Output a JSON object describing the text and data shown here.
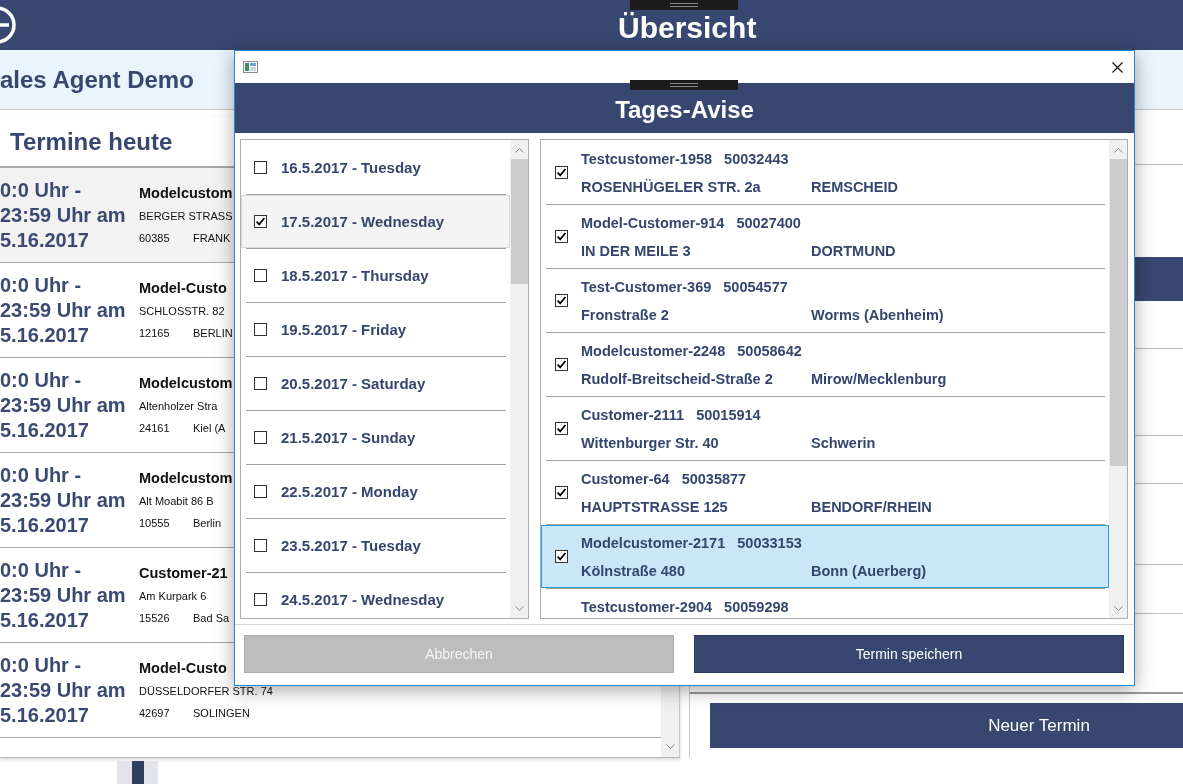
{
  "app": {
    "title": "Übersicht",
    "subtitle": "ales Agent Demo"
  },
  "appointments": {
    "title": "Termine heute",
    "rows": [
      {
        "time": "0:0 Uhr - 23:59 Uhr am 5.16.2017",
        "customer": "Modelcustom",
        "street": "BERGER STRASS",
        "zip": "60385",
        "city": "FRANK",
        "selected": true
      },
      {
        "time": "0:0 Uhr - 23:59 Uhr am 5.16.2017",
        "customer": "Model-Custo",
        "street": "SCHLOSSTR. 82",
        "zip": "12165",
        "city": "BERLIN",
        "selected": false
      },
      {
        "time": "0:0 Uhr - 23:59 Uhr am 5.16.2017",
        "customer": "Modelcustom",
        "street": "Altenholzer Stra",
        "zip": "24161",
        "city": "Kiel (A",
        "selected": false
      },
      {
        "time": "0:0 Uhr - 23:59 Uhr am 5.16.2017",
        "customer": "Modelcustom",
        "street": "Alt Moabit 86 B",
        "zip": "10555",
        "city": "Berlin",
        "selected": false
      },
      {
        "time": "0:0 Uhr - 23:59 Uhr am 5.16.2017",
        "customer": "Customer-21",
        "street": "Am Kurpark 6",
        "zip": "15526",
        "city": "Bad Sa",
        "selected": false
      },
      {
        "time": "0:0 Uhr - 23:59 Uhr am 5.16.2017",
        "customer": "Model-Custo",
        "street": "DÜSSELDORFER STR. 74",
        "zip": "42697",
        "city": "SOLINGEN",
        "selected": false
      }
    ]
  },
  "side_panel": {
    "button": "Neuer Termin"
  },
  "dialog": {
    "title": "Tages-Avise",
    "days": [
      {
        "label": "16.5.2017 - Tuesday",
        "checked": false,
        "selected": false
      },
      {
        "label": "17.5.2017 - Wednesday",
        "checked": true,
        "selected": true
      },
      {
        "label": "18.5.2017 - Thursday",
        "checked": false,
        "selected": false
      },
      {
        "label": "19.5.2017 - Friday",
        "checked": false,
        "selected": false
      },
      {
        "label": "20.5.2017 - Saturday",
        "checked": false,
        "selected": false
      },
      {
        "label": "21.5.2017 - Sunday",
        "checked": false,
        "selected": false
      },
      {
        "label": "22.5.2017 - Monday",
        "checked": false,
        "selected": false
      },
      {
        "label": "23.5.2017 - Tuesday",
        "checked": false,
        "selected": false
      },
      {
        "label": "24.5.2017 - Wednesday",
        "checked": false,
        "selected": false
      }
    ],
    "customers": [
      {
        "name": "Testcustomer-1958",
        "number": "50032443",
        "street": "ROSENHÜGELER STR. 2a",
        "city": "REMSCHEID",
        "checked": true,
        "selected": false
      },
      {
        "name": "Model-Customer-914",
        "number": "50027400",
        "street": "IN DER MEILE 3",
        "city": "DORTMUND",
        "checked": true,
        "selected": false
      },
      {
        "name": "Test-Customer-369",
        "number": "50054577",
        "street": "Fronstraße 2",
        "city": "Worms (Abenheim)",
        "checked": true,
        "selected": false
      },
      {
        "name": "Modelcustomer-2248",
        "number": "50058642",
        "street": "Rudolf-Breitscheid-Straße 2",
        "city": "Mirow/Mecklenburg",
        "checked": true,
        "selected": false
      },
      {
        "name": "Customer-2111",
        "number": "50015914",
        "street": "Wittenburger Str. 40",
        "city": "Schwerin",
        "checked": true,
        "selected": false
      },
      {
        "name": "Customer-64",
        "number": "50035877",
        "street": "HAUPTSTRASSE 125",
        "city": "BENDORF/RHEIN",
        "checked": true,
        "selected": false
      },
      {
        "name": "Modelcustomer-2171",
        "number": "50033153",
        "street": "Kölnstraße 480",
        "city": "Bonn (Auerberg)",
        "checked": true,
        "selected": true
      },
      {
        "name": "Testcustomer-2904",
        "number": "50059298",
        "selected": false
      }
    ],
    "buttons": [
      {
        "label": "Abbrechen",
        "kind": "secondary"
      },
      {
        "label": "Termin speichern",
        "kind": "primary"
      }
    ]
  }
}
